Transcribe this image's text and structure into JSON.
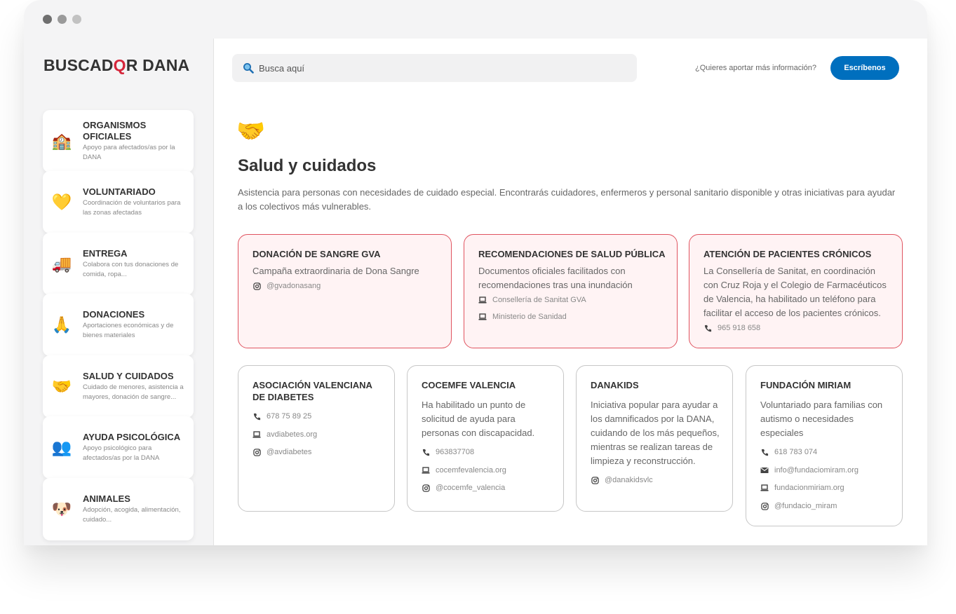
{
  "app": {
    "logo_pre": "BUSCAD",
    "logo_q": "Q",
    "logo_post": "R DANA"
  },
  "header": {
    "search_placeholder": "Busca aquí",
    "info_question": "¿Quieres aportar más información?",
    "write_button": "Escríbenos"
  },
  "sidebar": {
    "items": [
      {
        "icon": "🏫",
        "icon_name": "school-building-icon",
        "title": "ORGANISMOS OFICIALES",
        "desc": "Apoyo para afectados/as por la DANA"
      },
      {
        "icon": "💛",
        "icon_name": "yellow-heart-icon",
        "title": "VOLUNTARIADO",
        "desc": "Coordinación de voluntarios para las zonas afectadas"
      },
      {
        "icon": "🚚",
        "icon_name": "delivery-truck-icon",
        "title": "ENTREGA",
        "desc": "Colabora con tus donaciones de comida, ropa..."
      },
      {
        "icon": "🙏",
        "icon_name": "praying-hands-icon",
        "title": "DONACIONES",
        "desc": "Aportaciones económicas y de bienes materiales"
      },
      {
        "icon": "🤝",
        "icon_name": "handshake-icon",
        "title": "SALUD Y CUIDADOS",
        "desc": "Cuidado de menores, asistencia a mayores, donación de sangre..."
      },
      {
        "icon": "👥",
        "icon_name": "people-icon",
        "title": "AYUDA PSICOLÓGICA",
        "desc": "Apoyo psicológico para afectados/as por la DANA"
      },
      {
        "icon": "🐶",
        "icon_name": "dog-face-icon",
        "title": "ANIMALES",
        "desc": "Adopción, acogida, alimentación, cuidado..."
      }
    ]
  },
  "section": {
    "emoji": "🤝",
    "title": "Salud y cuidados",
    "description": "Asistencia para personas con necesidades de cuidado especial. Encontrarás cuidadores, enfermeros y personal sanitario disponible y otras iniciativas para ayudar a los colectivos más vulnerables."
  },
  "featured": [
    {
      "title": "DONACIÓN DE SANGRE GVA",
      "body": "Campaña extraordinaria de Dona Sangre",
      "contacts": [
        {
          "icon": "instagram-icon",
          "text": "@gvadonasang"
        }
      ]
    },
    {
      "title": "RECOMENDACIONES DE SALUD PÚBLICA",
      "body": "Documentos oficiales facilitados  con recomendaciones tras una inundación",
      "contacts": [
        {
          "icon": "laptop-icon",
          "text": "Consellería de Sanitat GVA"
        },
        {
          "icon": "laptop-icon",
          "text": "Ministerio de Sanidad"
        }
      ]
    },
    {
      "title": "ATENCIÓN DE PACIENTES CRÓNICOS",
      "body": "La Consellería de Sanitat, en coordinación con Cruz Roja y el Colegio de Farmacéuticos de Valencia, ha habilitado un teléfono para facilitar el acceso de los pacientes crónicos.",
      "contacts": [
        {
          "icon": "phone-icon",
          "text": "965 918 658"
        }
      ]
    }
  ],
  "cards": [
    {
      "title": "ASOCIACIÓN VALENCIANA DE DIABETES",
      "body": "",
      "contacts": [
        {
          "icon": "phone-icon",
          "text": "678 75 89 25"
        },
        {
          "icon": "laptop-icon",
          "text": "avdiabetes.org"
        },
        {
          "icon": "instagram-icon",
          "text": "@avdiabetes"
        }
      ]
    },
    {
      "title": "COCEMFE VALENCIA",
      "body": "Ha habilitado un punto de solicitud de ayuda para personas con discapacidad.",
      "contacts": [
        {
          "icon": "phone-icon",
          "text": "963837708"
        },
        {
          "icon": "laptop-icon",
          "text": "cocemfevalencia.org"
        },
        {
          "icon": "instagram-icon",
          "text": "@cocemfe_valencia"
        }
      ]
    },
    {
      "title": "DANAKIDS",
      "body": "Iniciativa popular para ayudar a los damnificados por la DANA, cuidando de los más pequeños, mientras se realizan tareas de limpieza y reconstrucción.",
      "contacts": [
        {
          "icon": "instagram-icon",
          "text": "@danakidsvlc"
        }
      ]
    },
    {
      "title": "FUNDACIÓN MIRIAM",
      "body": "Voluntariado para familias con autismo o necesidades especiales",
      "contacts": [
        {
          "icon": "phone-icon",
          "text": "618 783 074"
        },
        {
          "icon": "mail-icon",
          "text": "info@fundaciomiram.org"
        },
        {
          "icon": "laptop-icon",
          "text": "fundacionmiriam.org"
        },
        {
          "icon": "instagram-icon",
          "text": "@fundacio_miram"
        }
      ]
    }
  ]
}
